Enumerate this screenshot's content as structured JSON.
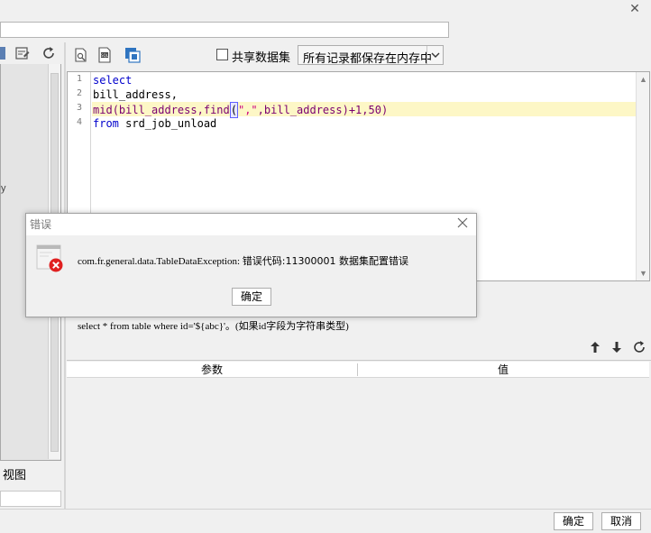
{
  "window": {
    "close_glyph": "✕"
  },
  "left_panel": {
    "edge_tick": "y",
    "view_tab": "视图"
  },
  "toolbar": {
    "share_dataset_label": "共享数据集",
    "share_dataset_checked": false,
    "record_mode_value": "所有记录都保存在内存中"
  },
  "editor": {
    "line_numbers": [
      "1",
      "2",
      "3",
      "4"
    ],
    "lines": [
      {
        "parts": [
          {
            "t": "select",
            "c": "kw"
          }
        ]
      },
      {
        "parts": [
          {
            "t": "bill_address,",
            "c": ""
          }
        ]
      },
      {
        "parts": [
          {
            "t": "mid",
            "c": "fn"
          },
          {
            "t": "(bill_address,",
            "c": "fn"
          },
          {
            "t": "find",
            "c": "fn"
          },
          {
            "t": "(",
            "c": "caret"
          },
          {
            "t": "\",\"",
            "c": "str"
          },
          {
            "t": ",bill_address)",
            "c": "fn"
          },
          {
            "t": "+1,",
            "c": "num"
          },
          {
            "t": "50",
            "c": "num"
          },
          {
            "t": ")",
            "c": "num"
          }
        ]
      },
      {
        "parts": [
          {
            "t": "from",
            "c": "kw"
          },
          {
            "t": " srd_job_unload",
            "c": ""
          }
        ]
      }
    ],
    "highlighted_line": 3
  },
  "hint": {
    "text": "select * from table where id='${abc}'。(如果id字段为字符串类型)"
  },
  "params": {
    "columns": [
      "参数",
      "值"
    ]
  },
  "footer": {
    "ok_label": "确定",
    "cancel_label": "取消"
  },
  "error_dialog": {
    "title": "错误",
    "message_prefix": "com.fr.general.data.TableDataException: ",
    "message_zh": "错误代码:11300001 数据集配置错误",
    "ok_label": "确定"
  },
  "colors": {
    "keyword": "#0000cc",
    "function": "#7a0070",
    "string": "#cc0080",
    "highlight_line": "#fdf7c6",
    "error_icon": "#e02020"
  }
}
